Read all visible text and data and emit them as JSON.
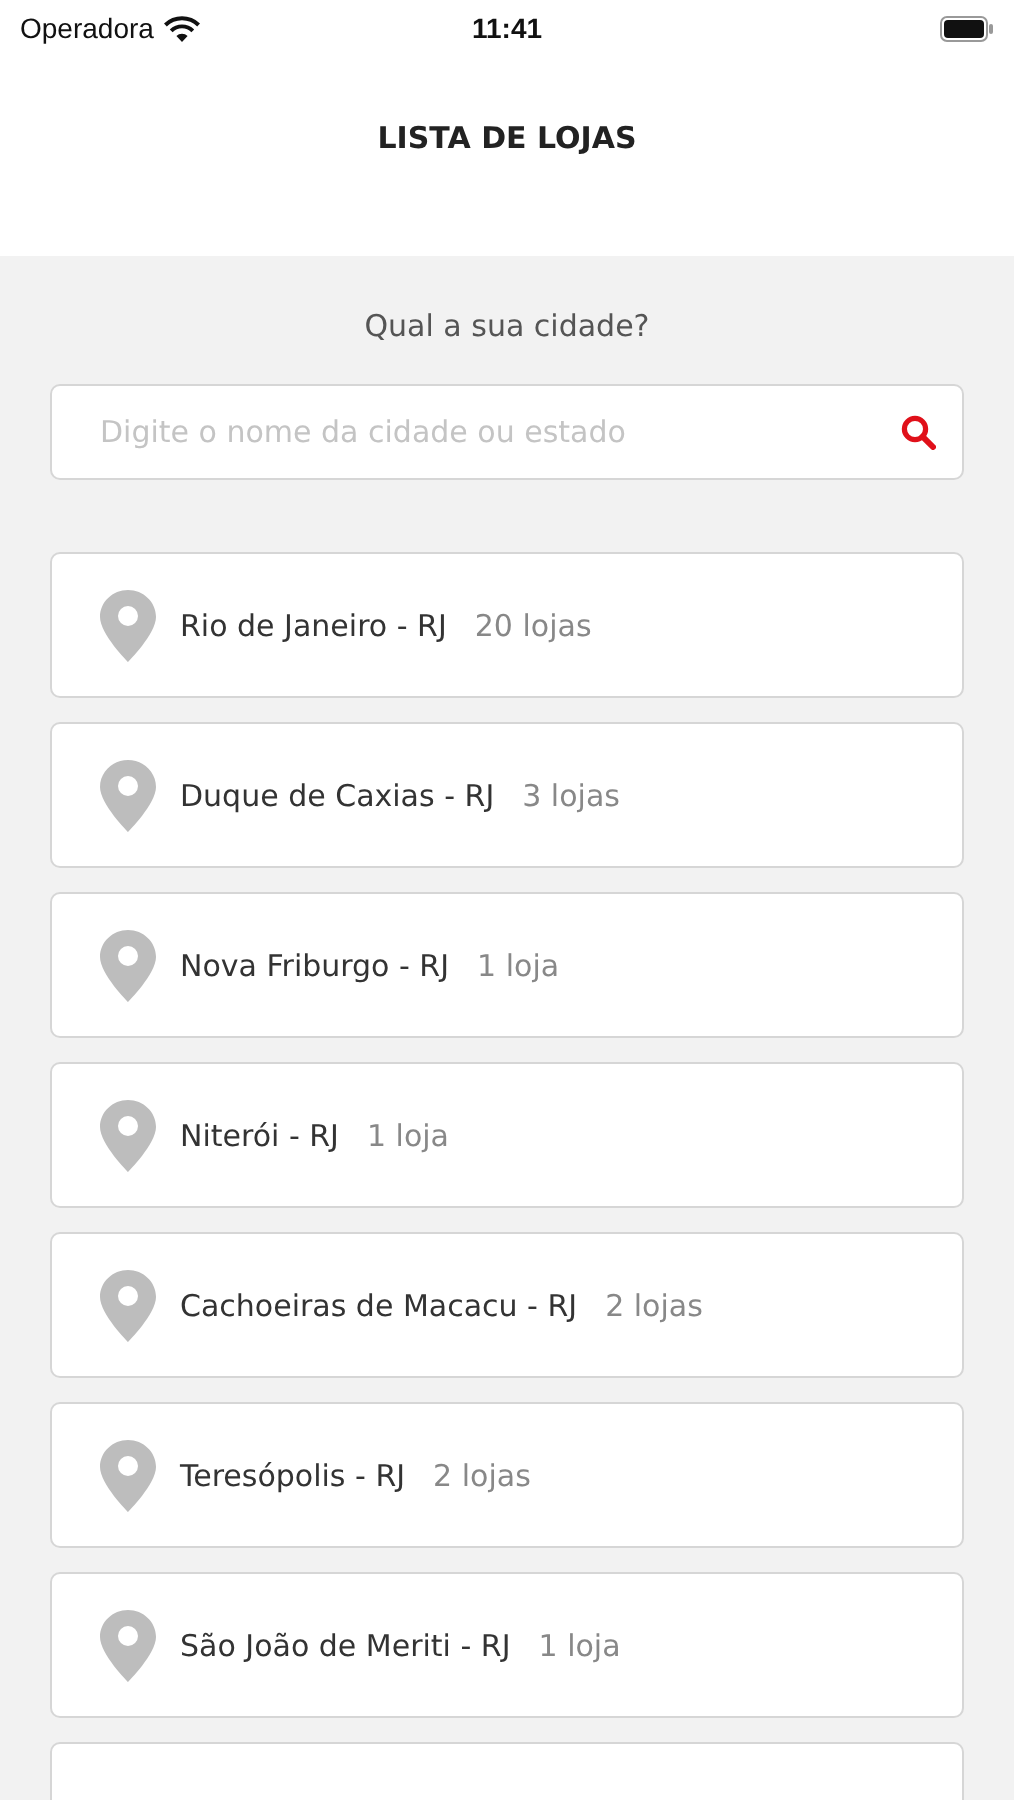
{
  "status_bar": {
    "carrier": "Operadora",
    "time": "11:41"
  },
  "header": {
    "title": "LISTA DE LOJAS"
  },
  "search": {
    "prompt": "Qual a sua cidade?",
    "placeholder": "Digite o nome da cidade ou estado"
  },
  "cities": [
    {
      "name": "Rio de Janeiro - RJ",
      "count": "20 lojas"
    },
    {
      "name": "Duque de Caxias - RJ",
      "count": "3 lojas"
    },
    {
      "name": "Nova Friburgo - RJ",
      "count": "1 loja"
    },
    {
      "name": "Niterói - RJ",
      "count": "1 loja"
    },
    {
      "name": "Cachoeiras de Macacu - RJ",
      "count": "2 lojas"
    },
    {
      "name": "Teresópolis - RJ",
      "count": "2 lojas"
    },
    {
      "name": "São João de Meriti - RJ",
      "count": "1 loja"
    }
  ]
}
